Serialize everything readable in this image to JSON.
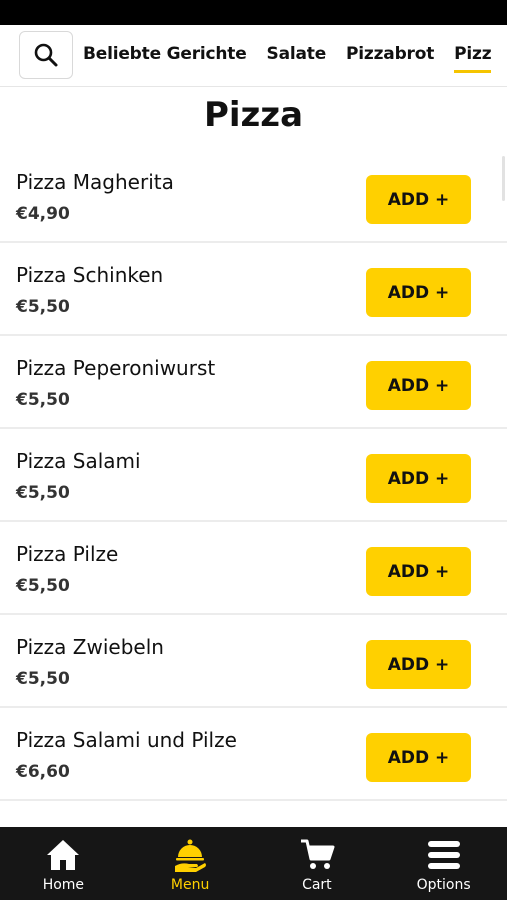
{
  "category_tabs": [
    {
      "label": "Beliebte Gerichte"
    },
    {
      "label": "Salate"
    },
    {
      "label": "Pizzabrot"
    },
    {
      "label": "Pizz"
    }
  ],
  "section": {
    "title": "Pizza"
  },
  "items": [
    {
      "name": "Pizza Magherita",
      "price": "€4,90",
      "button": "ADD +"
    },
    {
      "name": "Pizza Schinken",
      "price": "€5,50",
      "button": "ADD +"
    },
    {
      "name": "Pizza Peperoniwurst",
      "price": "€5,50",
      "button": "ADD +"
    },
    {
      "name": "Pizza Salami",
      "price": "€5,50",
      "button": "ADD +"
    },
    {
      "name": "Pizza Pilze",
      "price": "€5,50",
      "button": "ADD +"
    },
    {
      "name": "Pizza Zwiebeln",
      "price": "€5,50",
      "button": "ADD +"
    },
    {
      "name": "Pizza Salami und Pilze",
      "price": "€6,60",
      "button": "ADD +"
    }
  ],
  "bottom_nav": [
    {
      "label": "Home",
      "icon": "home-icon"
    },
    {
      "label": "Menu",
      "icon": "cloche-icon"
    },
    {
      "label": "Cart",
      "icon": "cart-icon"
    },
    {
      "label": "Options",
      "icon": "menu-icon"
    }
  ],
  "colors": {
    "accent": "#ffd000",
    "nav_background": "#161616"
  }
}
